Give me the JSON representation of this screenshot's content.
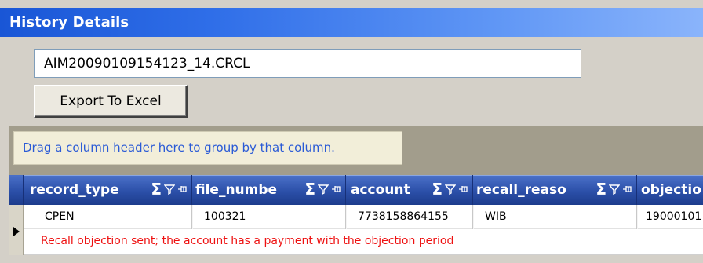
{
  "window": {
    "title": "History Details"
  },
  "file": {
    "name": "AIM20090109154123_14.CRCL"
  },
  "toolbar": {
    "export_label": "Export To Excel"
  },
  "grid": {
    "group_hint": "Drag a column header here to group by that column.",
    "columns": [
      {
        "label": "record_type"
      },
      {
        "label": "file_numbe"
      },
      {
        "label": "account"
      },
      {
        "label": "recall_reaso"
      },
      {
        "label": "objectio"
      }
    ],
    "rows": [
      {
        "cells": [
          "CPEN",
          "100321",
          "7738158864155",
          "WIB",
          "19000101"
        ],
        "preview": "Recall objection sent; the account has a payment with the objection period"
      }
    ],
    "column_icons": [
      "sum-icon",
      "filter-icon",
      "pin-icon"
    ]
  },
  "colors": {
    "title_bar": "#2f6ee8",
    "header": "#2b4fa8",
    "group_hint_text": "#2a5ad6",
    "preview_text": "#ee1111"
  }
}
